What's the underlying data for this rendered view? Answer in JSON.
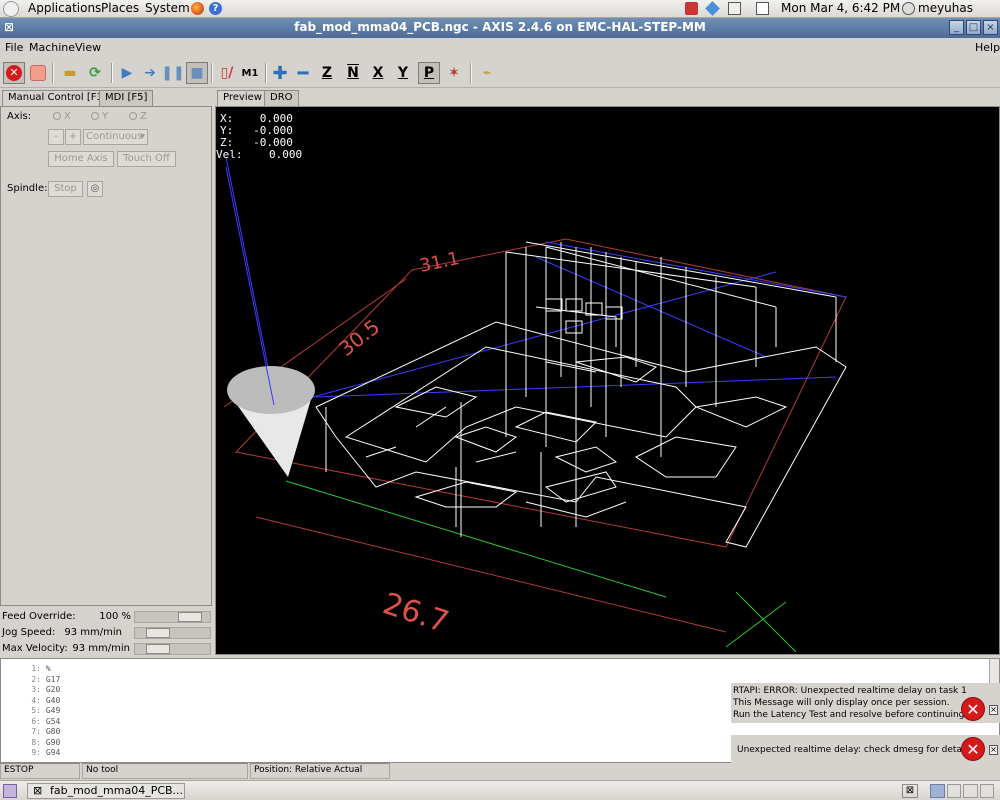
{
  "top_panel": {
    "menus": [
      "Applications",
      "Places",
      "System"
    ],
    "clock": "Mon Mar  4,  6:42 PM",
    "user": "meyuhas"
  },
  "window": {
    "title": "fab_mod_mma04_PCB.ngc - AXIS 2.4.6 on EMC-HAL-STEP-MM",
    "controls": [
      "_",
      "□",
      "×"
    ]
  },
  "menubar": {
    "file": "File",
    "machine": "Machine",
    "view": "View",
    "help": "Help"
  },
  "left_panel": {
    "tabs": [
      "Manual Control [F3]",
      "MDI [F5]"
    ],
    "axis_label": "Axis:",
    "axes": [
      "X",
      "Y",
      "Z"
    ],
    "minus": "-",
    "plus": "+",
    "jog_mode": "Continuous",
    "home_axis": "Home Axis",
    "touch_off": "Touch Off",
    "spindle_label": "Spindle:",
    "spindle_stop": "Stop"
  },
  "overrides": {
    "feed_label": "Feed Override:",
    "feed_value": "100 %",
    "feed_level": 100,
    "jog_label": "Jog Speed:",
    "jog_value": "93 mm/min",
    "jog_level": 0.22,
    "maxvel_label": "Max Velocity:",
    "maxvel_value": "93 mm/min",
    "maxvel_level": 0.22
  },
  "view_tabs": [
    "Preview",
    "DRO"
  ],
  "dro": {
    "x": "X:    0.000",
    "y": "Y:   -0.000",
    "z": "Z:   -0.000",
    "vel": "Vel:    0.000"
  },
  "dimensions": {
    "top": "31.1",
    "side": "30.5",
    "bottom": "26.7"
  },
  "gcode": [
    {
      "n": "1:",
      "code": "%"
    },
    {
      "n": "2:",
      "code": "G17"
    },
    {
      "n": "3:",
      "code": "G20"
    },
    {
      "n": "4:",
      "code": "G40"
    },
    {
      "n": "5:",
      "code": "G49"
    },
    {
      "n": "6:",
      "code": "G54"
    },
    {
      "n": "7:",
      "code": "G80"
    },
    {
      "n": "8:",
      "code": "G90"
    },
    {
      "n": "9:",
      "code": "G94"
    }
  ],
  "errors": [
    {
      "text": "RTAPI: ERROR: Unexpected realtime delay on task 1\nThis Message will only display once per session.\nRun the Latency Test and resolve before continuing."
    },
    {
      "text": "Unexpected realtime delay: check dmesg for details."
    }
  ],
  "statusbar": {
    "state": "ESTOP",
    "tool": "No tool",
    "position": "Position: Relative Actual"
  },
  "taskbar": {
    "task": "fab_mod_mma04_PCB..."
  },
  "colors": {
    "titlebar": "#5a7aa6",
    "preview_bg": "#000000",
    "toolpath": "#ffffff",
    "traverse": "#3b3bff",
    "dimension": "#e0504a",
    "x_axis": "#2fc52f",
    "error": "#d7191c"
  }
}
